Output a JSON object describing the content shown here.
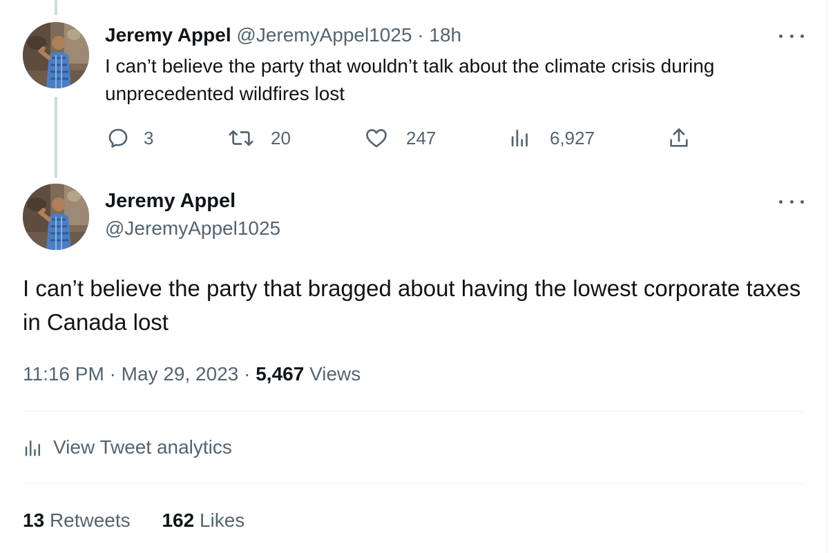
{
  "reply_tweet": {
    "author_name": "Jeremy Appel",
    "handle": "@JeremyAppel1025",
    "separator": "·",
    "time_ago": "18h",
    "text": "I can’t believe the party that wouldn’t talk about the climate crisis during unprecedented wildfires lost",
    "actions": {
      "replies": "3",
      "retweets": "20",
      "likes": "247",
      "views": "6,927"
    },
    "icons": [
      "reply-icon",
      "retweet-icon",
      "like-icon",
      "views-icon",
      "share-icon",
      "more-icon"
    ]
  },
  "main_tweet": {
    "author_name": "Jeremy Appel",
    "handle": "@JeremyAppel1025",
    "text": "I can’t believe the party that bragged about having the lowest corporate taxes in Canada lost",
    "time": "11:16 PM",
    "separator": "·",
    "date": "May 29, 2023",
    "views_count": "5,467",
    "views_label": "Views",
    "analytics_label": "View Tweet analytics",
    "retweets_count": "13",
    "retweets_label": "Retweets",
    "likes_count": "162",
    "likes_label": "Likes"
  },
  "colors": {
    "text_primary": "#0f1419",
    "text_secondary": "#536471",
    "thread_line": "#cfd9de",
    "divider": "#eff3f4"
  }
}
